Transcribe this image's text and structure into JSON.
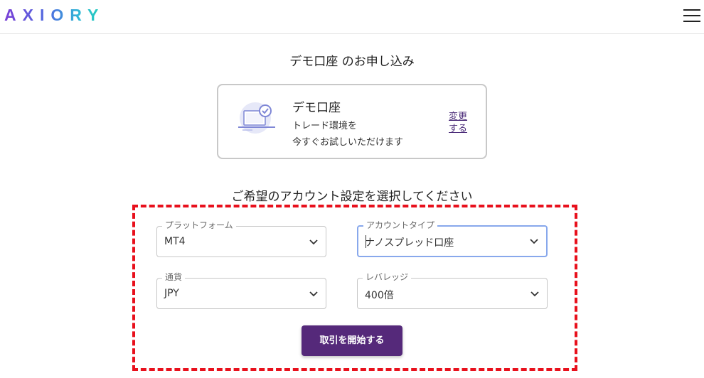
{
  "header": {
    "logo_text": "AXIORY",
    "menu_icon": "hamburger-menu-icon"
  },
  "page": {
    "title": "デモ口座 のお申し込み"
  },
  "account_card": {
    "icon": "laptop-check-icon",
    "name": "デモ口座",
    "description_line1": "トレード環境を",
    "description_line2": "今すぐお試しいただけます",
    "change_link": "変更する"
  },
  "settings": {
    "heading": "ご希望のアカウント設定を選択してください",
    "highlight_color": "#e8101c",
    "fields": [
      {
        "label": "プラットフォーム",
        "value": "MT4"
      },
      {
        "label": "アカウントタイプ",
        "value": "ナノスプレッド口座"
      },
      {
        "label": "通貨",
        "value": "JPY"
      },
      {
        "label": "レバレッジ",
        "value": "400倍"
      }
    ],
    "submit_label": "取引を開始する",
    "submit_color": "#55297a"
  }
}
